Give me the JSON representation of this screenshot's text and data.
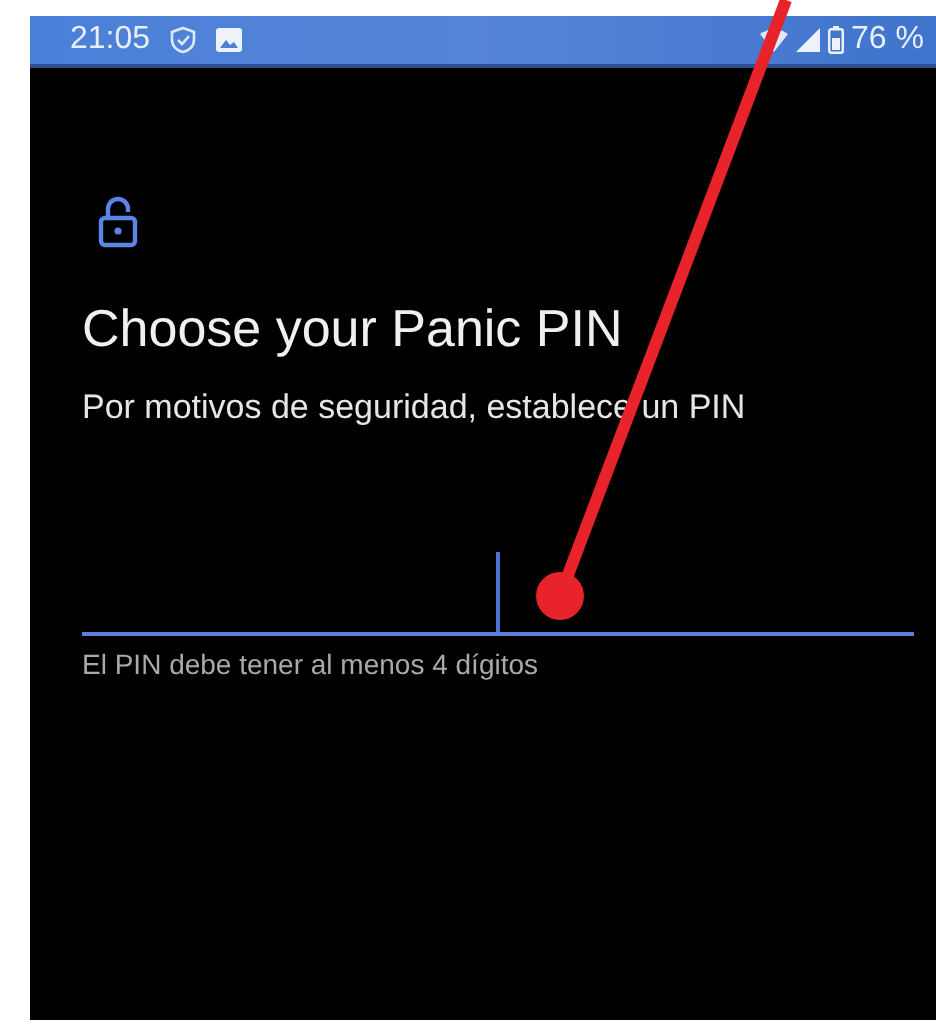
{
  "status_bar": {
    "time": "21:05",
    "battery": "76 %"
  },
  "screen": {
    "title": "Choose your Panic PIN",
    "subtitle": "Por motivos de seguridad, establece un PIN"
  },
  "pin_field": {
    "helper": "El PIN debe tener al menos 4 dígitos"
  }
}
